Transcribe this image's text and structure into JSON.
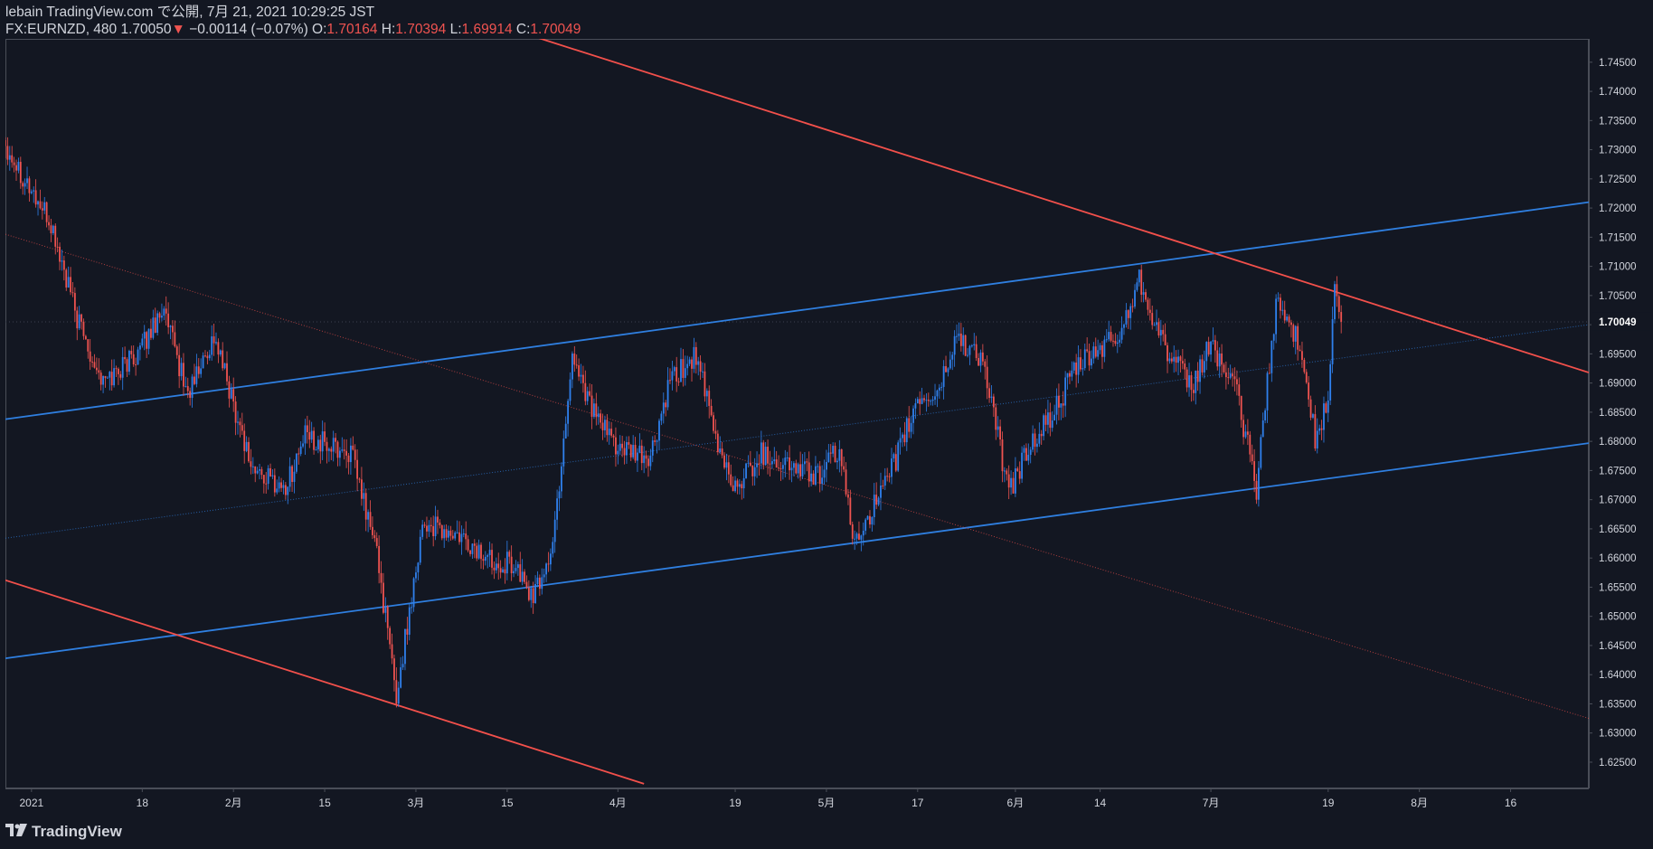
{
  "header": {
    "line1": "lebain TradingView.com で公開, 7月 21, 2021 10:29:25 JST",
    "symbol": "FX:EURNZD, 480 1.70050",
    "change_arrow": "▼",
    "change": "−0.00114 (−0.07%)",
    "o_label": "O:",
    "o_value": "1.70164",
    "h_label": "H:",
    "h_value": "1.70394",
    "l_label": "L:",
    "l_value": "1.69914",
    "c_label": "C:",
    "c_value": "1.70049"
  },
  "footer": {
    "brand": "TradingView",
    "logo_icon": "tradingview-logo-icon"
  },
  "colors": {
    "background": "#131722",
    "up": "#2962ff",
    "up_light": "#2f80ed",
    "down": "#ef5350",
    "channel_blue": "#2f7fe0",
    "channel_red": "#f2504b",
    "axis_text": "#d1d4dc",
    "axis_border": "#4a4e58"
  },
  "chart_data": {
    "type": "candlestick",
    "symbol": "FX:EURNZD",
    "interval": "480",
    "ylim": [
      1.6205,
      1.749
    ],
    "y_ticks": [
      "1.74500",
      "1.74000",
      "1.73500",
      "1.73000",
      "1.72500",
      "1.72000",
      "1.71500",
      "1.71000",
      "1.70500",
      "1.70000",
      "1.69500",
      "1.69000",
      "1.68500",
      "1.68000",
      "1.67500",
      "1.67000",
      "1.66500",
      "1.66000",
      "1.65500",
      "1.65000",
      "1.64500",
      "1.64000",
      "1.63500",
      "1.63000",
      "1.62500"
    ],
    "x_range": [
      "2020-12-28",
      "2021-08-28"
    ],
    "x_ticks": [
      {
        "label": "2021",
        "date": "2021-01-01"
      },
      {
        "label": "18",
        "date": "2021-01-18"
      },
      {
        "label": "2月",
        "date": "2021-02-01"
      },
      {
        "label": "15",
        "date": "2021-02-15"
      },
      {
        "label": "3月",
        "date": "2021-03-01"
      },
      {
        "label": "15",
        "date": "2021-03-15"
      },
      {
        "label": "4月",
        "date": "2021-04-01"
      },
      {
        "label": "19",
        "date": "2021-04-19"
      },
      {
        "label": "5月",
        "date": "2021-05-03"
      },
      {
        "label": "17",
        "date": "2021-05-17"
      },
      {
        "label": "6月",
        "date": "2021-06-01"
      },
      {
        "label": "14",
        "date": "2021-06-14"
      },
      {
        "label": "7月",
        "date": "2021-07-01"
      },
      {
        "label": "19",
        "date": "2021-07-19"
      },
      {
        "label": "8月",
        "date": "2021-08-02"
      },
      {
        "label": "16",
        "date": "2021-08-16"
      }
    ],
    "last_price": "1.70049",
    "last_price_value": 1.70049,
    "price_path": [
      {
        "date": "2020-12-28",
        "close": 1.731
      },
      {
        "date": "2021-01-04",
        "close": 1.717
      },
      {
        "date": "2021-01-08",
        "close": 1.701
      },
      {
        "date": "2021-01-12",
        "close": 1.69
      },
      {
        "date": "2021-01-18",
        "close": 1.696
      },
      {
        "date": "2021-01-21",
        "close": 1.703
      },
      {
        "date": "2021-01-25",
        "close": 1.688
      },
      {
        "date": "2021-01-29",
        "close": 1.698
      },
      {
        "date": "2021-02-04",
        "close": 1.675
      },
      {
        "date": "2021-02-09",
        "close": 1.672
      },
      {
        "date": "2021-02-12",
        "close": 1.681
      },
      {
        "date": "2021-02-16",
        "close": 1.679
      },
      {
        "date": "2021-02-19",
        "close": 1.678
      },
      {
        "date": "2021-02-23",
        "close": 1.661
      },
      {
        "date": "2021-02-26",
        "close": 1.636
      },
      {
        "date": "2021-03-02",
        "close": 1.666
      },
      {
        "date": "2021-03-08",
        "close": 1.663
      },
      {
        "date": "2021-03-12",
        "close": 1.66
      },
      {
        "date": "2021-03-16",
        "close": 1.659
      },
      {
        "date": "2021-03-19",
        "close": 1.653
      },
      {
        "date": "2021-03-22",
        "close": 1.662
      },
      {
        "date": "2021-03-25",
        "close": 1.695
      },
      {
        "date": "2021-03-29",
        "close": 1.683
      },
      {
        "date": "2021-04-02",
        "close": 1.678
      },
      {
        "date": "2021-04-06",
        "close": 1.677
      },
      {
        "date": "2021-04-09",
        "close": 1.69
      },
      {
        "date": "2021-04-13",
        "close": 1.695
      },
      {
        "date": "2021-04-16",
        "close": 1.68
      },
      {
        "date": "2021-04-19",
        "close": 1.672
      },
      {
        "date": "2021-04-23",
        "close": 1.678
      },
      {
        "date": "2021-04-27",
        "close": 1.676
      },
      {
        "date": "2021-05-02",
        "close": 1.674
      },
      {
        "date": "2021-05-05",
        "close": 1.679
      },
      {
        "date": "2021-05-07",
        "close": 1.663
      },
      {
        "date": "2021-05-12",
        "close": 1.672
      },
      {
        "date": "2021-05-17",
        "close": 1.687
      },
      {
        "date": "2021-05-20",
        "close": 1.688
      },
      {
        "date": "2021-05-23",
        "close": 1.698
      },
      {
        "date": "2021-05-27",
        "close": 1.694
      },
      {
        "date": "2021-05-31",
        "close": 1.671
      },
      {
        "date": "2021-06-03",
        "close": 1.679
      },
      {
        "date": "2021-06-07",
        "close": 1.685
      },
      {
        "date": "2021-06-10",
        "close": 1.692
      },
      {
        "date": "2021-06-14",
        "close": 1.696
      },
      {
        "date": "2021-06-17",
        "close": 1.698
      },
      {
        "date": "2021-06-20",
        "close": 1.708
      },
      {
        "date": "2021-06-24",
        "close": 1.696
      },
      {
        "date": "2021-06-28",
        "close": 1.689
      },
      {
        "date": "2021-07-01",
        "close": 1.697
      },
      {
        "date": "2021-07-05",
        "close": 1.688
      },
      {
        "date": "2021-07-08",
        "close": 1.672
      },
      {
        "date": "2021-07-11",
        "close": 1.704
      },
      {
        "date": "2021-07-15",
        "close": 1.696
      },
      {
        "date": "2021-07-17",
        "close": 1.68
      },
      {
        "date": "2021-07-19",
        "close": 1.687
      },
      {
        "date": "2021-07-20",
        "close": 1.706
      },
      {
        "date": "2021-07-21",
        "close": 1.7005
      }
    ],
    "trendlines": [
      {
        "color": "blue",
        "style": "solid",
        "from": {
          "date": "2020-12-28",
          "price": 1.6838
        },
        "to": {
          "date": "2021-08-28",
          "price": 1.721
        }
      },
      {
        "color": "blue",
        "style": "solid",
        "from": {
          "date": "2020-12-28",
          "price": 1.6428
        },
        "to": {
          "date": "2021-08-28",
          "price": 1.6797
        }
      },
      {
        "color": "blue",
        "style": "dotted",
        "from": {
          "date": "2020-12-28",
          "price": 1.6634
        },
        "to": {
          "date": "2021-08-28",
          "price": 1.7
        }
      },
      {
        "color": "red",
        "style": "solid",
        "from": {
          "date": "2021-03-18",
          "price": 1.7498
        },
        "to": {
          "date": "2021-08-28",
          "price": 1.6918
        }
      },
      {
        "color": "red",
        "style": "solid",
        "from": {
          "date": "2020-12-28",
          "price": 1.6562
        },
        "to": {
          "date": "2021-04-05",
          "price": 1.6213
        }
      },
      {
        "color": "red",
        "style": "dotted",
        "from": {
          "date": "2020-12-28",
          "price": 1.7155
        },
        "to": {
          "date": "2021-08-28",
          "price": 1.6325
        }
      }
    ]
  }
}
